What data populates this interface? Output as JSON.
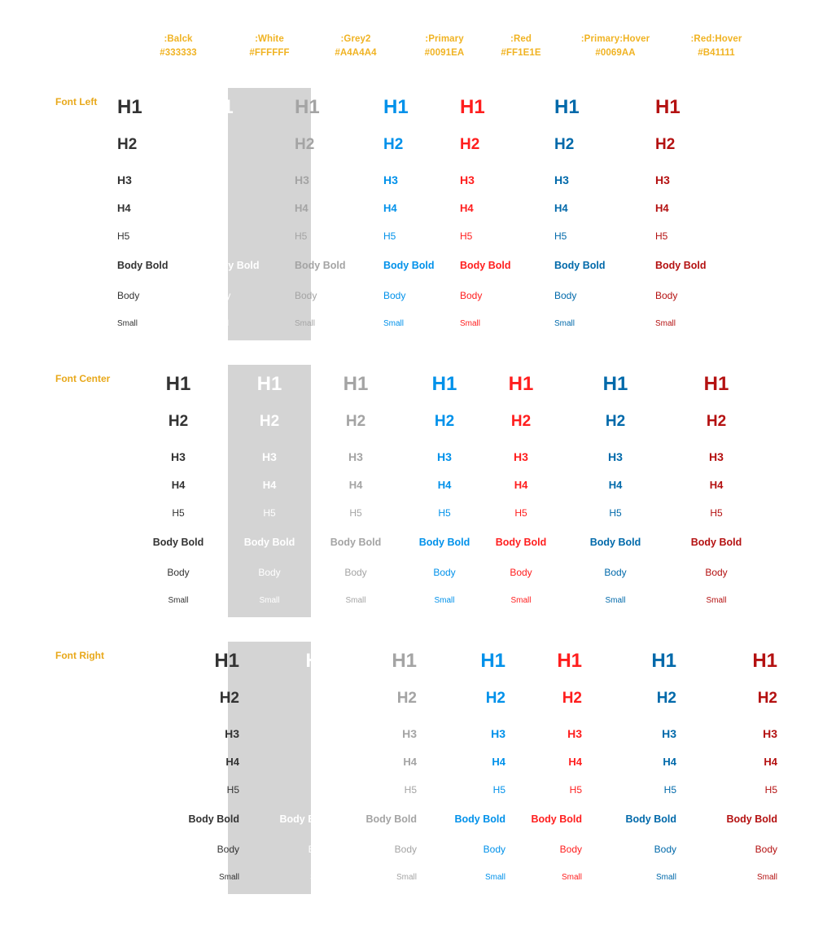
{
  "columns": [
    {
      "name": ":Balck",
      "hex": "#333333",
      "color": "#333333",
      "center": 219
    },
    {
      "name": ":White",
      "hex": "#FFFFFF",
      "color": "#FFFFFF",
      "center": 331
    },
    {
      "name": ":Grey2",
      "hex": "#A4A4A4",
      "color": "#A4A4A4",
      "center": 437
    },
    {
      "name": ":Primary",
      "hex": "#0091EA",
      "color": "#0091EA",
      "center": 546
    },
    {
      "name": ":Red",
      "hex": "#FF1E1E",
      "color": "#FF1E1E",
      "center": 640
    },
    {
      "name": ":Primary:Hover",
      "hex": "#0069AA",
      "color": "#0069AA",
      "center": 756
    },
    {
      "name": ":Red:Hover",
      "hex": "#B41111",
      "color": "#B41111",
      "center": 880
    }
  ],
  "type_rows": [
    {
      "label": "H1",
      "class": "t-h1"
    },
    {
      "label": "H2",
      "class": "t-h2"
    },
    {
      "label": "H3",
      "class": "t-h3"
    },
    {
      "label": "H4",
      "class": "t-h4"
    },
    {
      "label": "H5",
      "class": "t-h5"
    },
    {
      "label": "Body Bold",
      "class": "t-bb"
    },
    {
      "label": "Body",
      "class": "t-bd"
    },
    {
      "label": "Small",
      "class": "t-sm"
    }
  ],
  "sections": [
    {
      "label": "Font Left",
      "align": "left"
    },
    {
      "label": "Font Center",
      "align": "center"
    },
    {
      "label": "Font Right",
      "align": "right"
    }
  ],
  "theme": {
    "header_color": "#F0B323",
    "row_label_color": "#E8A81A",
    "white_panel_color": "#D4D4D4",
    "page_background": "#FFFFFF"
  }
}
